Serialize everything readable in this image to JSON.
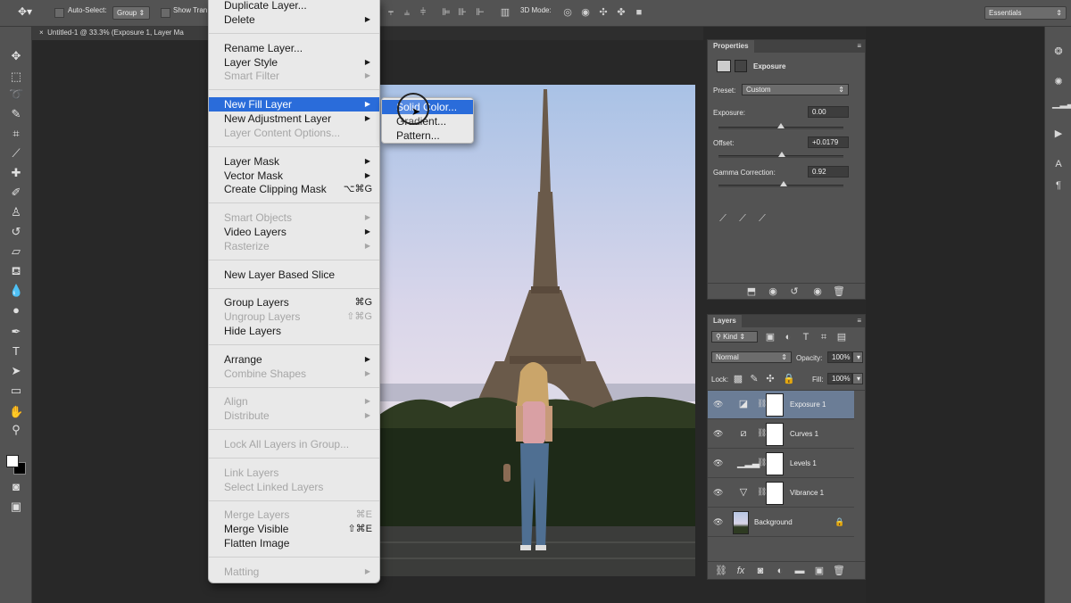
{
  "options_bar": {
    "auto_select_label": "Auto-Select:",
    "auto_select_value": "Group",
    "show_transform_label": "Show Tran",
    "mode_3d_label": "3D Mode:",
    "workspace": "Essentials"
  },
  "document": {
    "tab_title": "Untitled-1 @ 33.3% (Exposure 1, Layer Ma",
    "close_glyph": "×"
  },
  "menu": {
    "items": [
      {
        "label": "Duplicate Layer...",
        "disabled": false
      },
      {
        "label": "Delete",
        "disabled": false,
        "arrow": "▶"
      },
      {
        "label": "Rename Layer...",
        "disabled": false
      },
      {
        "label": "Layer Style",
        "disabled": false,
        "arrow": "▶"
      },
      {
        "label": "Smart Filter",
        "disabled": true,
        "arrow": "▶"
      },
      {
        "label": "New Fill Layer",
        "disabled": false,
        "arrow": "▶",
        "selected": true
      },
      {
        "label": "New Adjustment Layer",
        "disabled": false,
        "arrow": "▶"
      },
      {
        "label": "Layer Content Options...",
        "disabled": true
      },
      {
        "label": "Layer Mask",
        "disabled": false,
        "arrow": "▶"
      },
      {
        "label": "Vector Mask",
        "disabled": false,
        "arrow": "▶"
      },
      {
        "label": "Create Clipping Mask",
        "disabled": false,
        "shortcut": "⌥⌘G"
      },
      {
        "label": "Smart Objects",
        "disabled": true,
        "arrow": "▶"
      },
      {
        "label": "Video Layers",
        "disabled": false,
        "arrow": "▶"
      },
      {
        "label": "Rasterize",
        "disabled": true,
        "arrow": "▶"
      },
      {
        "label": "New Layer Based Slice",
        "disabled": false
      },
      {
        "label": "Group Layers",
        "disabled": false,
        "shortcut": "⌘G"
      },
      {
        "label": "Ungroup Layers",
        "disabled": true,
        "shortcut": "⇧⌘G"
      },
      {
        "label": "Hide Layers",
        "disabled": false
      },
      {
        "label": "Arrange",
        "disabled": false,
        "arrow": "▶"
      },
      {
        "label": "Combine Shapes",
        "disabled": true,
        "arrow": "▶"
      },
      {
        "label": "Align",
        "disabled": true,
        "arrow": "▶"
      },
      {
        "label": "Distribute",
        "disabled": true,
        "arrow": "▶"
      },
      {
        "label": "Lock All Layers in Group...",
        "disabled": true
      },
      {
        "label": "Link Layers",
        "disabled": true
      },
      {
        "label": "Select Linked Layers",
        "disabled": true
      },
      {
        "label": "Merge Layers",
        "disabled": true,
        "shortcut": "⌘E"
      },
      {
        "label": "Merge Visible",
        "disabled": false,
        "shortcut": "⇧⌘E"
      },
      {
        "label": "Flatten Image",
        "disabled": false
      },
      {
        "label": "Matting",
        "disabled": true,
        "arrow": "▶"
      }
    ]
  },
  "submenu": {
    "items": [
      {
        "label": "Solid Color...",
        "selected": true
      },
      {
        "label": "Gradient..."
      },
      {
        "label": "Pattern..."
      }
    ]
  },
  "properties": {
    "tab": "Properties",
    "title": "Exposure",
    "preset_label": "Preset:",
    "preset_value": "Custom",
    "exposure_label": "Exposure:",
    "exposure_value": "0.00",
    "offset_label": "Offset:",
    "offset_value": "+0.0179",
    "gamma_label": "Gamma Correction:",
    "gamma_value": "0.92",
    "exposure_level": 0.5,
    "offset_level": 0.51,
    "gamma_level": 0.52
  },
  "layers": {
    "tab": "Layers",
    "kind_label": "Kind",
    "blend_mode": "Normal",
    "opacity_label": "Opacity:",
    "opacity_value": "100%",
    "lock_label": "Lock:",
    "fill_label": "Fill:",
    "fill_value": "100%",
    "items": [
      {
        "name": "Exposure 1",
        "active": true
      },
      {
        "name": "Curves 1"
      },
      {
        "name": "Levels 1"
      },
      {
        "name": "Vibrance 1"
      },
      {
        "name": "Background"
      }
    ]
  },
  "colors": {
    "menu_highlight": "#2a6cda",
    "active_layer": "#6b7d96",
    "panel_bg": "#535353"
  }
}
